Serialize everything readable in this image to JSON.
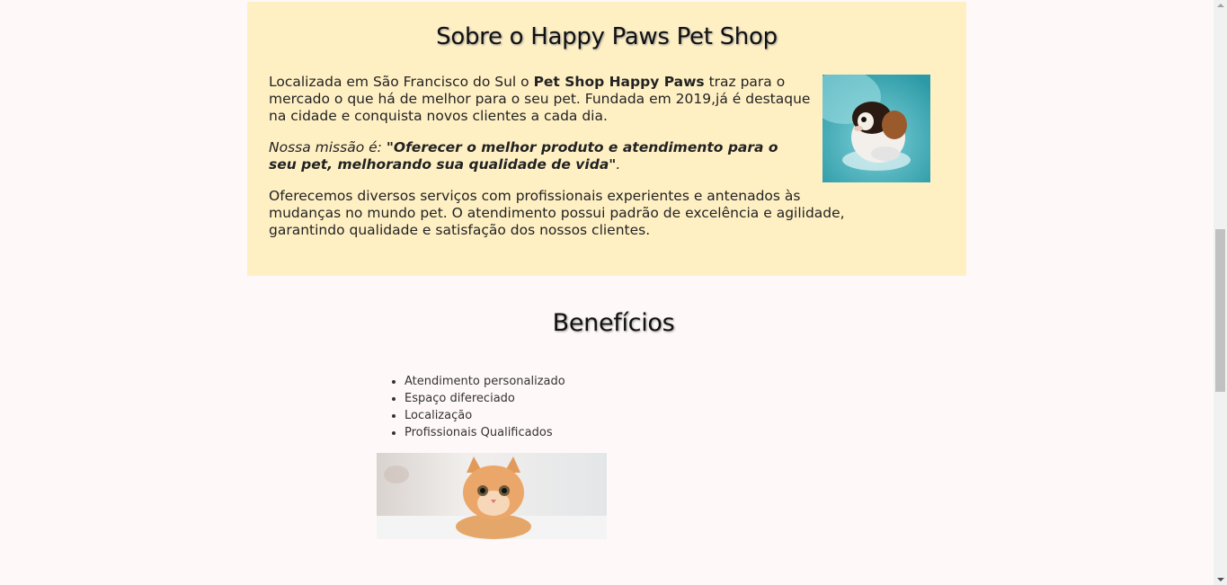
{
  "about": {
    "title": "Sobre o Happy Paws Pet Shop",
    "p1_before": "Localizada em São Francisco do Sul o ",
    "p1_bold": "Pet Shop Happy Paws",
    "p1_after": " traz para o mercado o que há de melhor para o seu pet. Fundada em 2019,já é destaque na cidade e conquista novos clientes a cada dia.",
    "mission_label": "Nossa missão é: ",
    "mission_quote": "\"Oferecer o melhor produto e atendimento para o seu pet, melhorando sua qualidade de vida\"",
    "mission_end": ".",
    "services": "Oferecemos diversos serviços com profissionais experientes e antenados às mudanças no mundo pet. O atendimento possui padrão de excelência e agilidade, garantindo qualidade e satisfação dos nossos clientes."
  },
  "benefits": {
    "title": "Benefícios",
    "items": [
      "Atendimento personalizado",
      "Espaço difereciado",
      "Localização",
      "Profissionais Qualificados"
    ]
  },
  "colors": {
    "page_background": "#fff8f9",
    "about_background": "#fff0c4"
  }
}
